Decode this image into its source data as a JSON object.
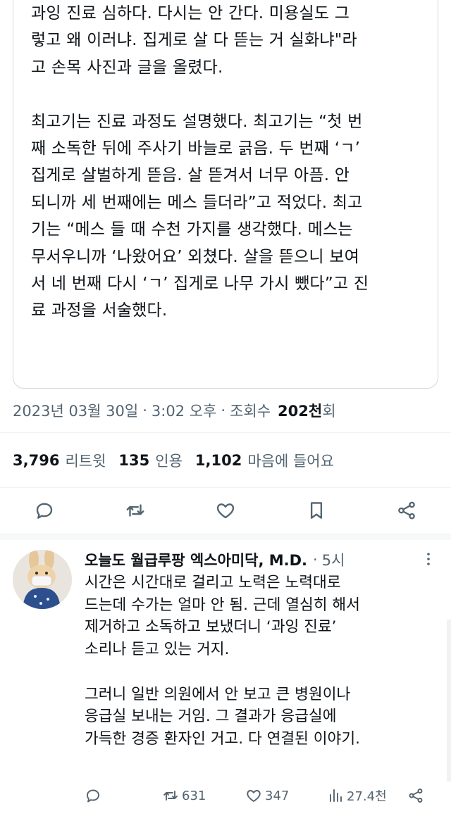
{
  "quote": {
    "paragraphs": [
      "과잉 진료 심하다. 다시는 안 간다. 미용실도 그\n렇고 왜 이러냐. 집게로 살 다 뜯는 거 실화냐\"라\n고 손목 사진과 글을 올렸다.",
      "최고기는 진료 과정도 설명했다. 최고기는 “첫 번\n째 소독한 뒤에 주사기 바늘로 긁음. 두 번째 ‘ㄱ’\n집게로 살벌하게 뜯음. 살 뜯겨서 너무 아픔. 안\n되니까 세 번째에는 메스 들더라”고 적었다. 최고\n기는 “메스 들 때 수천 가지를 생각했다. 메스는\n무서우니까 ‘나왔어요’ 외쳤다. 살을 뜯으니 보여\n서 네 번째 다시 ‘ㄱ’ 집게로 나무 가시 뺐다”고 진\n료 과정을 서술했다."
    ]
  },
  "tweet_meta": {
    "date": "2023년 03월 30일",
    "time": "3:02 오후",
    "views_label": "조회수",
    "views_count": "202천",
    "views_suffix": "회",
    "separator": "·"
  },
  "stats": {
    "retweets": {
      "count": "3,796",
      "label": "리트윗"
    },
    "quotes": {
      "count": "135",
      "label": "인용"
    },
    "likes": {
      "count": "1,102",
      "label": "마음에 들어요"
    }
  },
  "icons": {
    "main_actions": [
      "reply-icon",
      "retweet-icon",
      "like-icon",
      "bookmark-icon",
      "share-icon"
    ],
    "reply_actions": [
      "reply-icon",
      "retweet-icon",
      "like-icon",
      "views-icon",
      "share-icon"
    ],
    "more": "more-icon"
  },
  "reply": {
    "author_name": "오늘도 월급루팡 엑스아미닥, M.D.",
    "separator": "·",
    "time": "5시",
    "paragraphs": [
      "시간은 시간대로 걸리고 노력은 노력대로\n드는데 수가는 얼마 안 됨. 근데 열심히 해서\n제거하고 소독하고 보냈더니 ‘과잉 진료’\n소리나 듣고 있는 거지.",
      "그러니 일반 의원에서 안 보고 큰 병원이나\n응급실 보내는 거임. 그 결과가 응급실에\n가득한 경증 환자인 거고. 다 연결된 이야기."
    ],
    "retweet_count": "631",
    "like_count": "347",
    "view_count": "27.4천"
  },
  "colors": {
    "text": "#0f1419",
    "secondary": "#536471",
    "border": "#cfd9de"
  }
}
